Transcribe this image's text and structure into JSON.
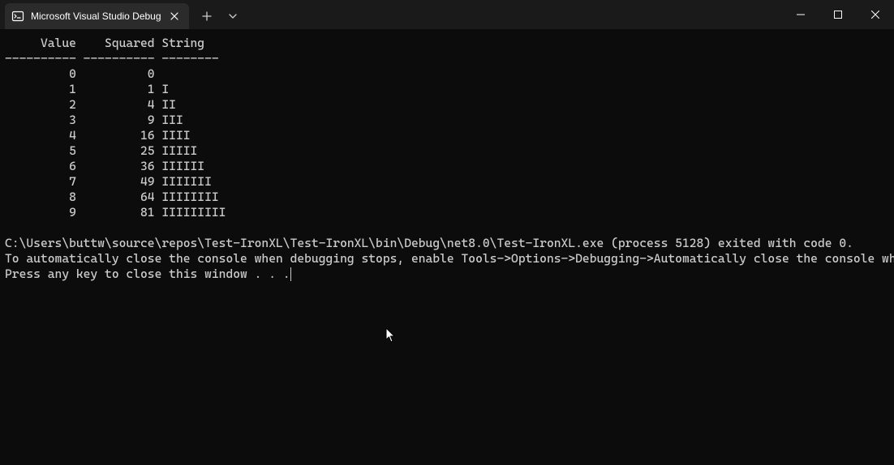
{
  "titlebar": {
    "tab_title": "Microsoft Visual Studio Debug"
  },
  "console": {
    "header": {
      "col1": "Value",
      "col2": "Squared",
      "col3": "String"
    },
    "separator": "---------- ---------- --------",
    "rows": [
      {
        "value": "0",
        "squared": "0",
        "str": ""
      },
      {
        "value": "1",
        "squared": "1",
        "str": "I"
      },
      {
        "value": "2",
        "squared": "4",
        "str": "II"
      },
      {
        "value": "3",
        "squared": "9",
        "str": "III"
      },
      {
        "value": "4",
        "squared": "16",
        "str": "IIII"
      },
      {
        "value": "5",
        "squared": "25",
        "str": "IIIII"
      },
      {
        "value": "6",
        "squared": "36",
        "str": "IIIIII"
      },
      {
        "value": "7",
        "squared": "49",
        "str": "IIIIIII"
      },
      {
        "value": "8",
        "squared": "64",
        "str": "IIIIIIII"
      },
      {
        "value": "9",
        "squared": "81",
        "str": "IIIIIIIII"
      }
    ],
    "exit_message": "C:\\Users\\buttw\\source\\repos\\Test-IronXL\\Test-IronXL\\bin\\Debug\\net8.0\\Test-IronXL.exe (process 5128) exited with code 0.",
    "auto_close_message": "To automatically close the console when debugging stops, enable Tools->Options->Debugging->Automatically close the console when debugging stops.",
    "press_key_message": "Press any key to close this window . . ."
  }
}
